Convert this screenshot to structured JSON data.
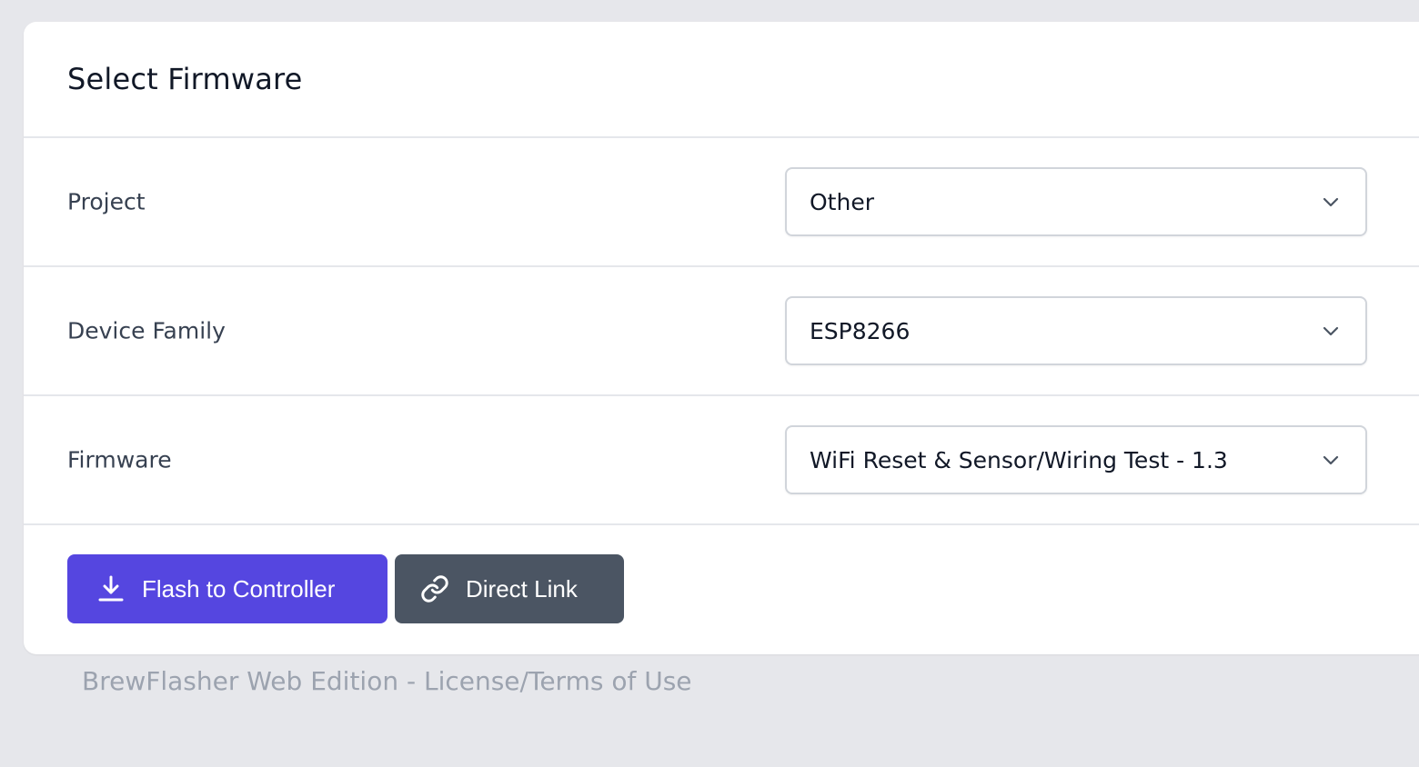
{
  "card": {
    "title": "Select Firmware"
  },
  "form": {
    "rows": [
      {
        "label": "Project",
        "selected": "Other"
      },
      {
        "label": "Device Family",
        "selected": "ESP8266"
      },
      {
        "label": "Firmware",
        "selected": "WiFi Reset & Sensor/Wiring Test - 1.3"
      }
    ]
  },
  "actions": {
    "flash_label": "Flash to Controller",
    "flash_icon": "download-icon",
    "link_label": "Direct Link",
    "link_icon": "link-icon"
  },
  "footer": {
    "text": "BrewFlasher Web Edition - License/Terms of Use"
  },
  "colors": {
    "background": "#e6e7eb",
    "primary": "#5546e0",
    "secondary": "#4b5563",
    "footer_text": "#9ca3af"
  }
}
